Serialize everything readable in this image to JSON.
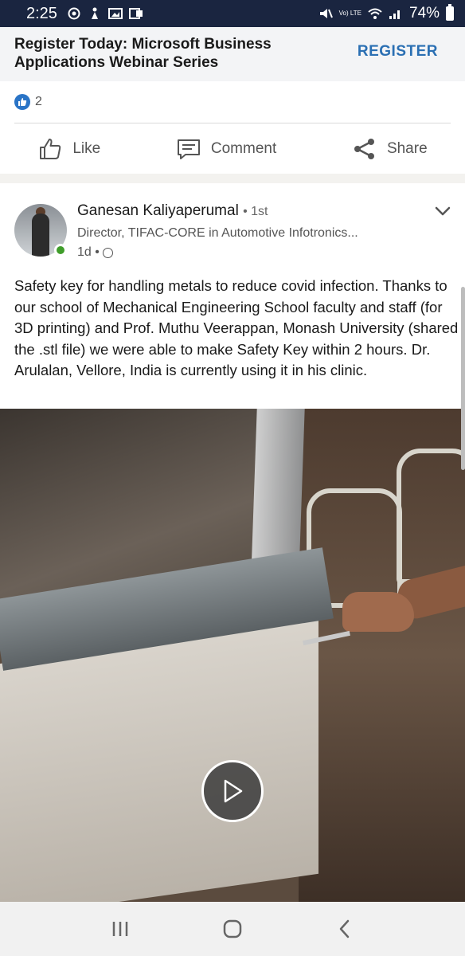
{
  "status_bar": {
    "time": "2:25",
    "volte": "Vo) LTE",
    "battery": "74%"
  },
  "ad": {
    "title": "Register Today: Microsoft Business Applications Webinar Series",
    "register_label": "REGISTER",
    "reaction_count": "2",
    "actions": {
      "like": "Like",
      "comment": "Comment",
      "share": "Share"
    }
  },
  "post": {
    "author": "Ganesan Kaliyaperumal",
    "degree": "• 1st",
    "headline": "Director, TIFAC-CORE in Automotive Infotronics...",
    "time": "1d •",
    "text": "Safety key for handling metals to reduce covid infection. Thanks to our school of Mechanical Engineering School faculty and staff (for 3D printing) and Prof. Muthu Veerappan, Monash University (shared the .stl file) we were able to make  Safety Key within 2 hours. Dr. Arulalan, Vellore, India is currently using it in his clinic."
  },
  "icons": {
    "like": "thumbs-up-icon",
    "comment": "comment-icon",
    "share": "share-icon",
    "play": "play-icon",
    "menu": "chevron-down-icon",
    "recents": "recent-apps-icon",
    "home": "home-icon",
    "back": "back-icon"
  },
  "colors": {
    "status_bar": "#1a2540",
    "accent": "#2a6fb3",
    "online": "#3f9d2a"
  }
}
